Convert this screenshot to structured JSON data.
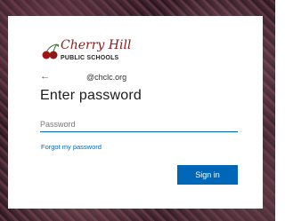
{
  "logo": {
    "script_text": "Cherry Hill",
    "sub_text": "PUBLIC SCHOOLS",
    "icon": "cherries-icon",
    "brand_color": "#8b1a1a"
  },
  "signin_panel": {
    "back_icon": "←",
    "identity": "@chclc.org",
    "title": "Enter password",
    "password_placeholder": "Password",
    "forgot_link": "Forgot my password",
    "signin_button": "Sign in"
  },
  "colors": {
    "accent": "#0067b8",
    "card_background": "#ffffff"
  }
}
